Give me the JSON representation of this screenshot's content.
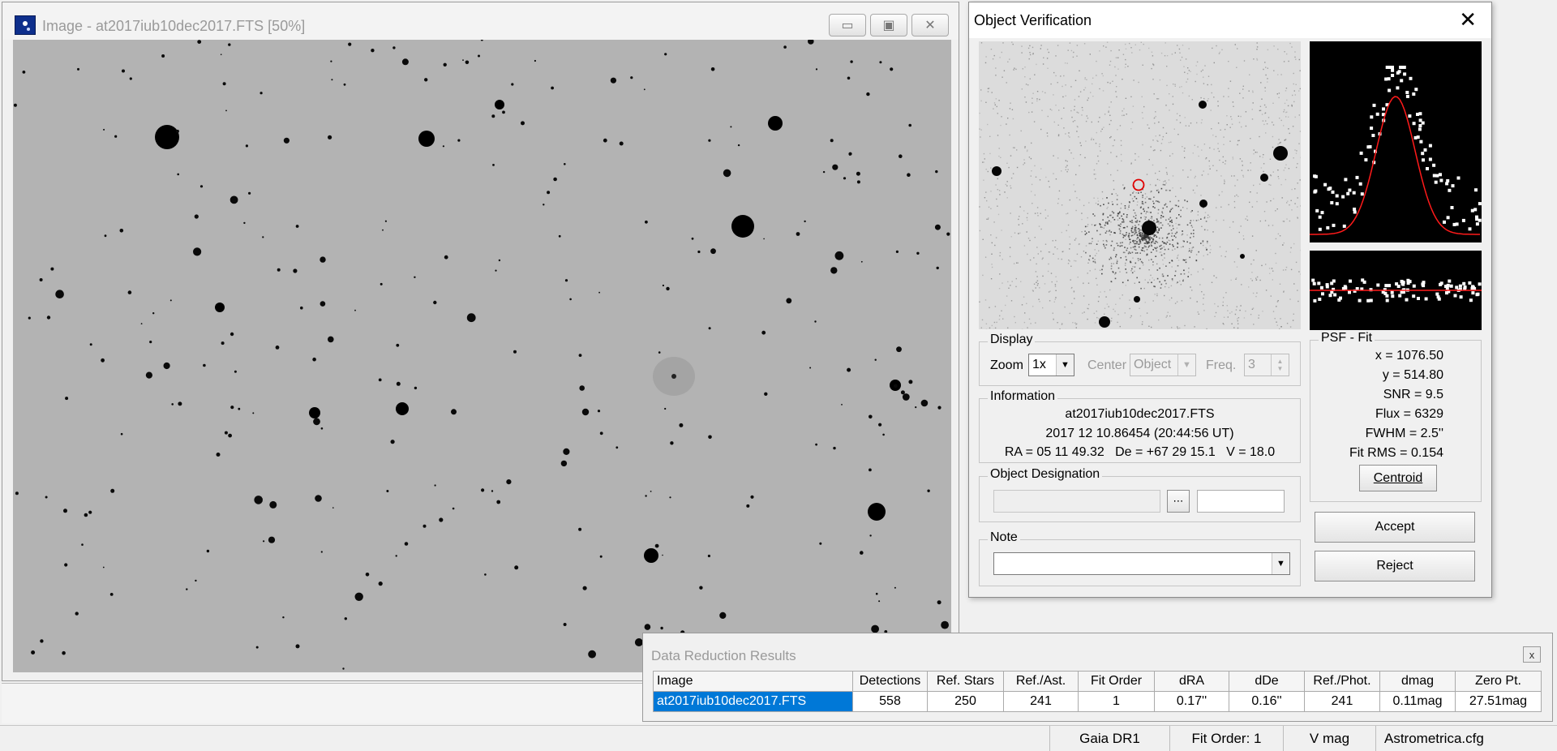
{
  "image_window": {
    "title": "Image - at2017iub10dec2017.FTS [50%]",
    "minimize_icon": "minimize-icon",
    "maximize_icon": "restore-icon",
    "close_icon": "close-icon"
  },
  "object_verification": {
    "title": "Object Verification",
    "close_glyph": "✕",
    "display": {
      "label": "Display",
      "zoom_label": "Zoom",
      "zoom_value": "1x",
      "center_label": "Center",
      "center_value": "Object",
      "freq_label": "Freq.",
      "freq_value": "3"
    },
    "information": {
      "label": "Information",
      "filename": "at2017iub10dec2017.FTS",
      "date": "2017 12 10.86454 (20:44:56 UT)",
      "coords": "RA = 05 11 49.32   De = +67 29 15.1   V = 18.0"
    },
    "designation": {
      "label": "Object Designation",
      "value": "",
      "value2": ""
    },
    "note": {
      "label": "Note",
      "value": ""
    },
    "psf_fit": {
      "label": "PSF - Fit",
      "x": "x = 1076.50",
      "y": "y = 514.80",
      "snr": "SNR = 9.5",
      "flux": "Flux = 6329",
      "fwhm": "FWHM = 2.5''",
      "fit_rms": "Fit RMS = 0.154",
      "centroid_label": "Centroid"
    },
    "accept_label": "Accept",
    "reject_label": "Reject"
  },
  "data_reduction": {
    "title": "Data Reduction Results",
    "close_glyph": "x",
    "columns": [
      "Image",
      "Detections",
      "Ref. Stars",
      "Ref./Ast.",
      "Fit Order",
      "dRA",
      "dDe",
      "Ref./Phot.",
      "dmag",
      "Zero Pt."
    ],
    "rows": [
      [
        "at2017iub10dec2017.FTS",
        "558",
        "250",
        "241",
        "1",
        "0.17''",
        "0.16''",
        "241",
        "0.11mag",
        "27.51mag"
      ]
    ]
  },
  "status_bar": {
    "catalog": "Gaia DR1",
    "fit_order": "Fit Order: 1",
    "mag": "V mag",
    "config": "Astrometrica.cfg"
  },
  "colors": {
    "selection": "#0078d7",
    "psf_curve": "#ff1a1a",
    "marker": "#e00000"
  }
}
